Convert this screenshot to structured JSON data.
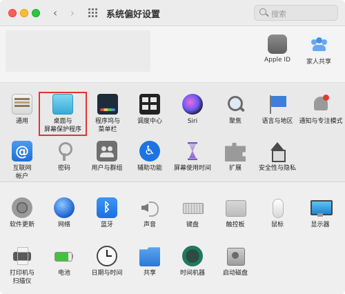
{
  "window": {
    "title": "系统偏好设置",
    "search_placeholder": "搜索"
  },
  "account": {
    "apple_id_label": "Apple ID",
    "family_label": "家人共享"
  },
  "section1": [
    {
      "label": "通用",
      "icon": "general-icon"
    },
    {
      "label": "桌面与",
      "label2": "屏幕保护程序",
      "icon": "desktop-screensaver-icon",
      "selected": true
    },
    {
      "label": "程序坞与",
      "label2": "菜单栏",
      "icon": "dock-icon"
    },
    {
      "label": "调度中心",
      "icon": "mission-control-icon"
    },
    {
      "label": "Siri",
      "icon": "siri-icon"
    },
    {
      "label": "聚焦",
      "icon": "spotlight-icon"
    },
    {
      "label": "语言与地区",
      "icon": "language-region-icon"
    },
    {
      "label": "通知与专注模式",
      "icon": "notifications-icon"
    },
    {
      "label": "互联网",
      "label2": "帐户",
      "icon": "internet-accounts-icon"
    },
    {
      "label": "密码",
      "icon": "passwords-icon"
    },
    {
      "label": "用户与群组",
      "icon": "users-groups-icon"
    },
    {
      "label": "辅助功能",
      "icon": "accessibility-icon"
    },
    {
      "label": "屏幕使用时间",
      "icon": "screen-time-icon"
    },
    {
      "label": "扩展",
      "icon": "extensions-icon"
    },
    {
      "label": "安全性与隐私",
      "icon": "security-privacy-icon"
    }
  ],
  "section2": [
    {
      "label": "软件更新",
      "icon": "software-update-icon"
    },
    {
      "label": "网络",
      "icon": "network-icon"
    },
    {
      "label": "蓝牙",
      "icon": "bluetooth-icon"
    },
    {
      "label": "声音",
      "icon": "sound-icon"
    },
    {
      "label": "键盘",
      "icon": "keyboard-icon"
    },
    {
      "label": "触控板",
      "icon": "trackpad-icon"
    },
    {
      "label": "鼠标",
      "icon": "mouse-icon"
    },
    {
      "label": "显示器",
      "icon": "displays-icon"
    },
    {
      "label": "打印机与",
      "label2": "扫描仪",
      "icon": "printers-scanners-icon"
    },
    {
      "label": "电池",
      "icon": "battery-icon"
    },
    {
      "label": "日期与时间",
      "icon": "date-time-icon"
    },
    {
      "label": "共享",
      "icon": "sharing-icon"
    },
    {
      "label": "时间机器",
      "icon": "time-machine-icon"
    },
    {
      "label": "启动磁盘",
      "icon": "startup-disk-icon"
    }
  ],
  "colors": {
    "highlight_border": "#e0342b",
    "close": "#fe5f57",
    "minimize": "#febc2e",
    "zoom": "#28c840"
  }
}
